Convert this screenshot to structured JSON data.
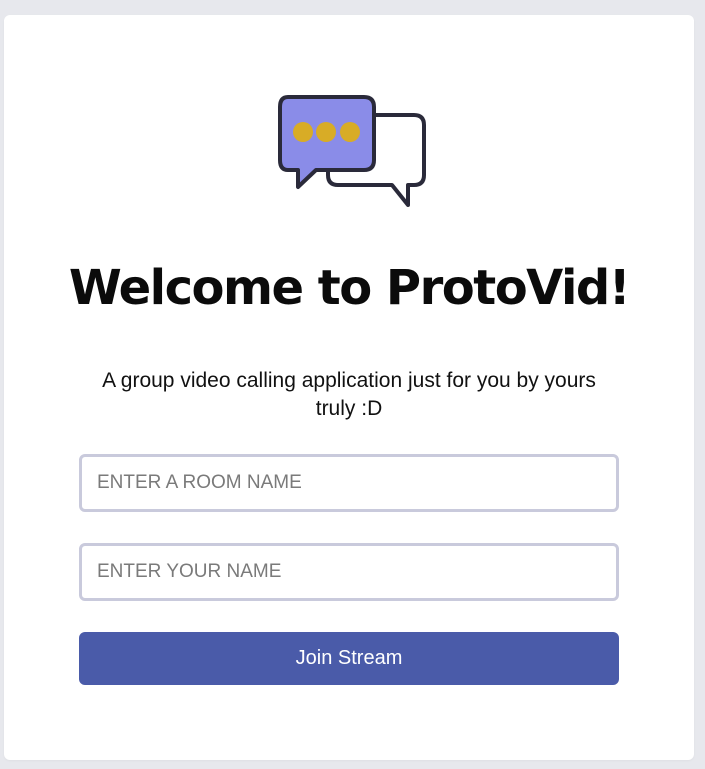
{
  "colors": {
    "page_background": "#e7e8ed",
    "card_background": "#ffffff",
    "bubble_front_fill": "#8a8ce8",
    "bubble_outline": "#2a2a3a",
    "dots": "#d8ac26",
    "input_border": "#c9cadc",
    "button_background": "#4a5ba9",
    "button_text": "#ffffff"
  },
  "logo": {
    "icon": "chat-bubbles-icon"
  },
  "header": {
    "title": "Welcome to ProtoVid!",
    "subtitle": "A group video calling application just for you by yours truly :D"
  },
  "form": {
    "room_placeholder": "ENTER A ROOM NAME",
    "room_value": "",
    "name_placeholder": "ENTER YOUR NAME",
    "name_value": "",
    "join_label": "Join Stream"
  }
}
